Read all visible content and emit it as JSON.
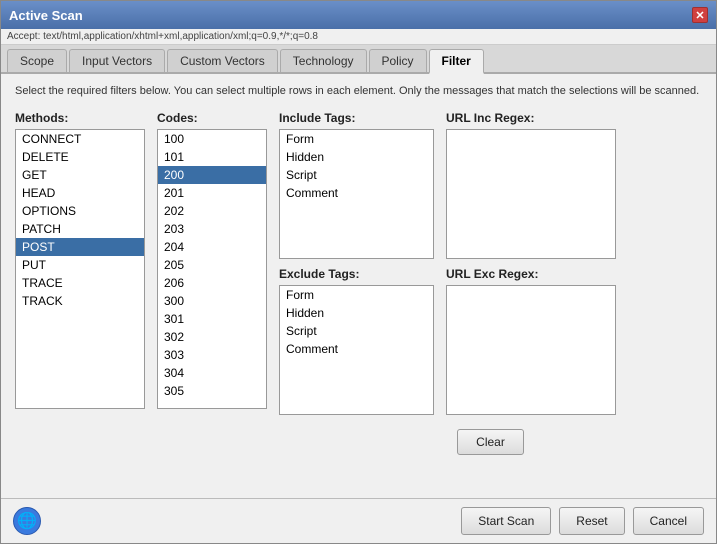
{
  "window": {
    "title": "Active Scan",
    "close_label": "✕"
  },
  "info_bar": {
    "text": "Accept: text/html,application/xhtml+xml,application/xml;q=0.9,*/*;q=0.8"
  },
  "tabs": [
    {
      "id": "scope",
      "label": "Scope",
      "active": false
    },
    {
      "id": "input-vectors",
      "label": "Input Vectors",
      "active": false
    },
    {
      "id": "custom-vectors",
      "label": "Custom Vectors",
      "active": false
    },
    {
      "id": "technology",
      "label": "Technology",
      "active": false
    },
    {
      "id": "policy",
      "label": "Policy",
      "active": false
    },
    {
      "id": "filter",
      "label": "Filter",
      "active": true
    }
  ],
  "description": "Select the required filters below. You can select multiple rows in each element. Only the messages that match the selections will be scanned.",
  "methods": {
    "label": "Methods:",
    "items": [
      {
        "value": "CONNECT",
        "selected": false
      },
      {
        "value": "DELETE",
        "selected": false
      },
      {
        "value": "GET",
        "selected": false
      },
      {
        "value": "HEAD",
        "selected": false
      },
      {
        "value": "OPTIONS",
        "selected": false
      },
      {
        "value": "PATCH",
        "selected": false
      },
      {
        "value": "POST",
        "selected": true
      },
      {
        "value": "PUT",
        "selected": false
      },
      {
        "value": "TRACE",
        "selected": false
      },
      {
        "value": "TRACK",
        "selected": false
      }
    ]
  },
  "codes": {
    "label": "Codes:",
    "items": [
      {
        "value": "100",
        "selected": false
      },
      {
        "value": "101",
        "selected": false
      },
      {
        "value": "200",
        "selected": true
      },
      {
        "value": "201",
        "selected": false
      },
      {
        "value": "202",
        "selected": false
      },
      {
        "value": "203",
        "selected": false
      },
      {
        "value": "204",
        "selected": false
      },
      {
        "value": "205",
        "selected": false
      },
      {
        "value": "206",
        "selected": false
      },
      {
        "value": "300",
        "selected": false
      },
      {
        "value": "301",
        "selected": false
      },
      {
        "value": "302",
        "selected": false
      },
      {
        "value": "303",
        "selected": false
      },
      {
        "value": "304",
        "selected": false
      },
      {
        "value": "305",
        "selected": false
      }
    ]
  },
  "include_tags": {
    "label": "Include Tags:",
    "items": [
      {
        "value": "Form",
        "selected": false
      },
      {
        "value": "Hidden",
        "selected": false
      },
      {
        "value": "Script",
        "selected": false
      },
      {
        "value": "Comment",
        "selected": false
      }
    ]
  },
  "url_inc_regex": {
    "label": "URL Inc Regex:",
    "value": ""
  },
  "exclude_tags": {
    "label": "Exclude Tags:",
    "items": [
      {
        "value": "Form",
        "selected": false
      },
      {
        "value": "Hidden",
        "selected": false
      },
      {
        "value": "Script",
        "selected": false
      },
      {
        "value": "Comment",
        "selected": false
      }
    ]
  },
  "url_exc_regex": {
    "label": "URL Exc Regex:",
    "value": ""
  },
  "buttons": {
    "clear": "Clear",
    "start_scan": "Start Scan",
    "reset": "Reset",
    "cancel": "Cancel"
  }
}
